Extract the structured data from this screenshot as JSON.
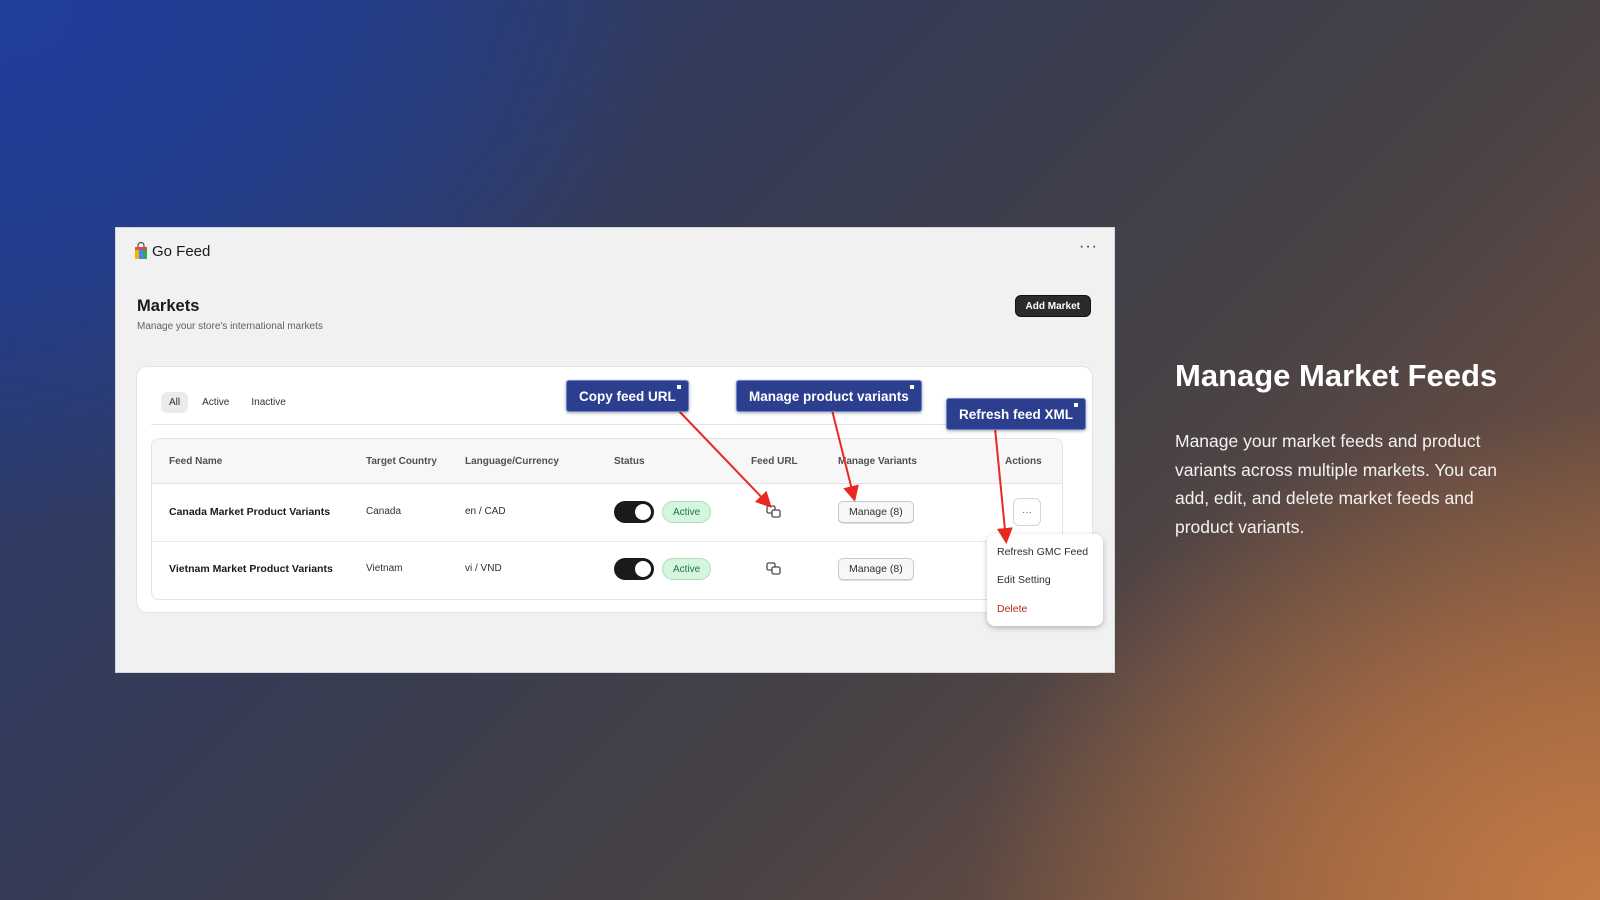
{
  "app": {
    "title": "Go Feed",
    "more_label": "···"
  },
  "page": {
    "title": "Markets",
    "subtitle": "Manage your store's international markets",
    "add_button": "Add Market"
  },
  "tabs": [
    {
      "label": "All",
      "selected": true
    },
    {
      "label": "Active",
      "selected": false
    },
    {
      "label": "Inactive",
      "selected": false
    }
  ],
  "table": {
    "headers": [
      "Feed Name",
      "Target Country",
      "Language/Currency",
      "Status",
      "Feed URL",
      "Manage Variants",
      "Actions"
    ],
    "rows": [
      {
        "feed_name": "Canada Market Product Variants",
        "country": "Canada",
        "lang_currency": "en / CAD",
        "status": "Active",
        "manage_label": "Manage (8)"
      },
      {
        "feed_name": "Vietnam Market Product Variants",
        "country": "Vietnam",
        "lang_currency": "vi / VND",
        "status": "Active",
        "manage_label": "Manage (8)"
      }
    ],
    "actions_label": "···"
  },
  "dropdown": {
    "items": [
      "Refresh GMC Feed",
      "Edit Setting",
      "Delete"
    ]
  },
  "callouts": {
    "copy_feed_url": "Copy feed URL",
    "manage_variants": "Manage product variants",
    "refresh_feed": "Refresh feed XML"
  },
  "side_panel": {
    "title": "Manage Market Feeds",
    "description": "Manage your market feeds and product variants across multiple markets. You can add, edit, and delete market feeds and product variants."
  },
  "colors": {
    "callout_bg": "#2b3f8e",
    "arrow": "#e8291f",
    "badge_bg": "#d6f5de",
    "badge_text": "#1a7a3c",
    "danger": "#b32b1b"
  }
}
